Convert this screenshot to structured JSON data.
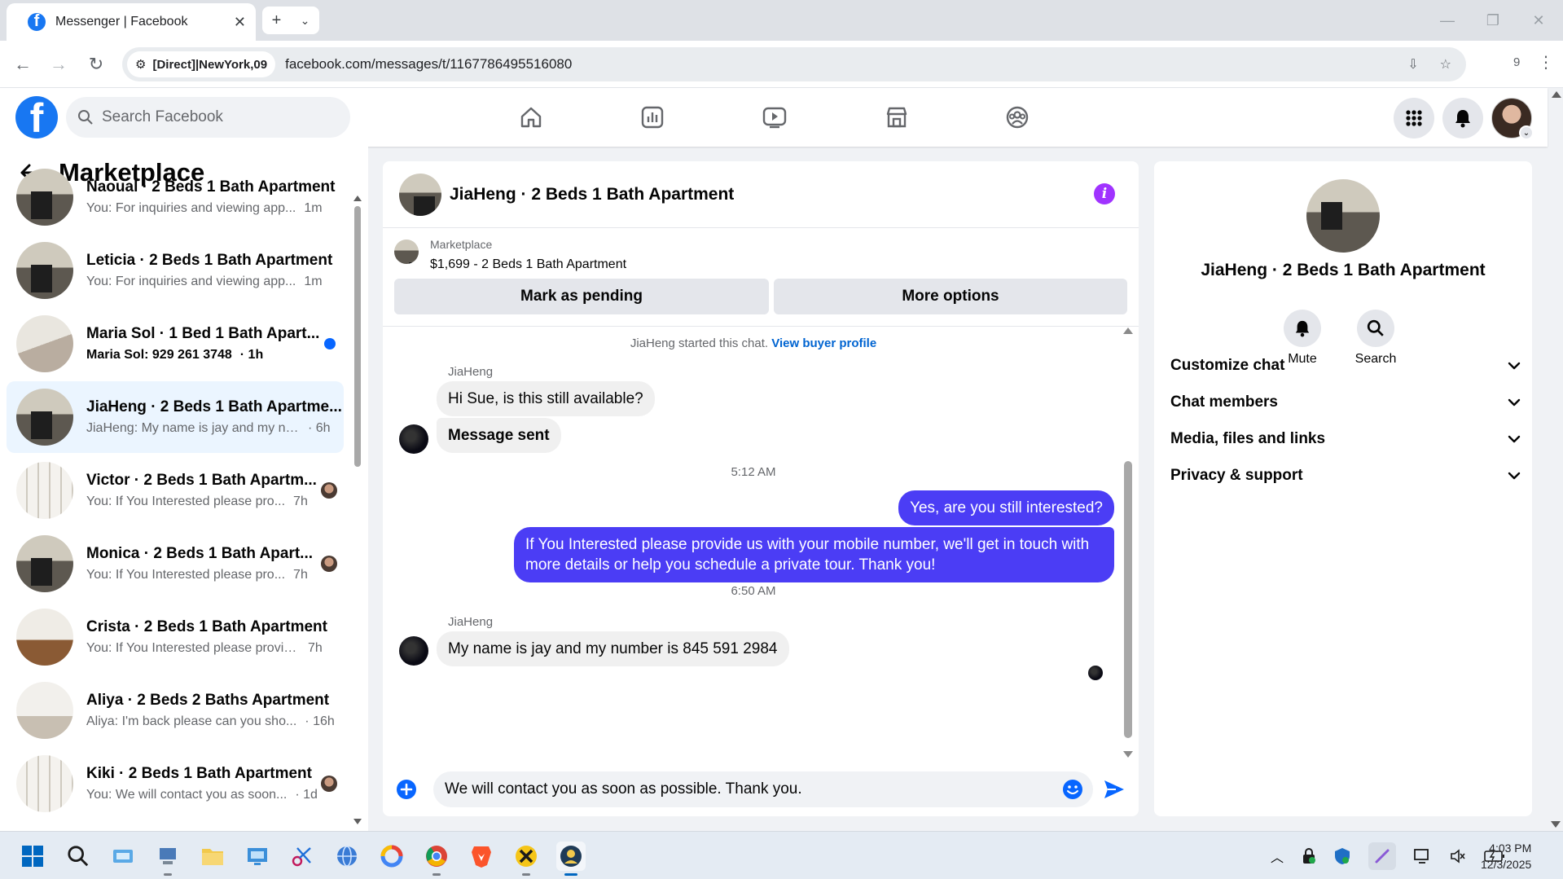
{
  "browser": {
    "tab_title": "Messenger | Facebook",
    "site_chip": "[Direct]|NewYork,09",
    "url": "facebook.com/messages/t/1167786495516080",
    "extensions_count": "9"
  },
  "facebook": {
    "search_placeholder": "Search Facebook"
  },
  "sidebar": {
    "title": "Marketplace",
    "conversations": [
      {
        "title": "Naoual · 2 Beds 1 Bath Apartment",
        "preview": "You: For inquiries and viewing app...",
        "time": "1m",
        "thumb": "kitchen"
      },
      {
        "title": "Leticia · 2 Beds 1 Bath Apartment",
        "preview": "You: For inquiries and viewing app...",
        "time": "1m",
        "thumb": "kitchen"
      },
      {
        "title": "Maria Sol · 1 Bed 1 Bath Apart...",
        "preview": "Maria Sol: 929 261 3748",
        "time": "· 1h",
        "thumb": "room",
        "unread": true
      },
      {
        "title": "JiaHeng · 2 Beds 1 Bath Apartme...",
        "preview": "JiaHeng: My name is jay and my nu...",
        "time": "· 6h",
        "thumb": "kitchen",
        "selected": true
      },
      {
        "title": "Victor · 2 Beds 1 Bath Apartm...",
        "preview": "You: If You Interested please pro...",
        "time": "7h",
        "thumb": "window",
        "seen": true
      },
      {
        "title": "Monica · 2 Beds 1 Bath Apart...",
        "preview": "You: If You Interested please pro...",
        "time": "7h",
        "thumb": "kitchen",
        "seen": true
      },
      {
        "title": "Crista · 2 Beds 1 Bath Apartment",
        "preview": "You: If You Interested please provid...",
        "time": "7h",
        "thumb": "floor"
      },
      {
        "title": "Aliya · 2 Beds 2 Baths Apartment",
        "preview": "Aliya: I'm back please can you sho...",
        "time": "· 16h",
        "thumb": "white"
      },
      {
        "title": "Kiki · 2 Beds 1 Bath Apartment",
        "preview": "You: We will contact you as soon...",
        "time": "· 1d",
        "thumb": "window",
        "seen": true
      }
    ]
  },
  "chat": {
    "title": "JiaHeng · 2 Beds 1 Bath Apartment",
    "marketplace_label": "Marketplace",
    "listing": "$1,699 - 2 Beds 1 Bath Apartment",
    "mark_pending": "Mark as pending",
    "more_options": "More options",
    "started_text": "JiaHeng started this chat.",
    "view_buyer": "View buyer profile",
    "sender1": "JiaHeng",
    "msg1": "Hi Sue, is this still available?",
    "msg2": "Message sent",
    "time1": "5:12 AM",
    "out1": "Yes, are you still interested?",
    "out2": "If You Interested please provide us with your mobile number, we'll get in touch with more details or help you schedule a private tour. Thank you!",
    "time2": "6:50 AM",
    "sender2": "JiaHeng",
    "msg3": "My name is jay and my number is 845 591 2984",
    "composer_text": "We will contact you as soon as possible. Thank you."
  },
  "info": {
    "title": "JiaHeng · 2 Beds 1 Bath Apartment",
    "mute": "Mute",
    "search": "Search",
    "sections": [
      "Customize chat",
      "Chat members",
      "Media, files and links",
      "Privacy & support"
    ]
  },
  "taskbar": {
    "time": "4:03 PM",
    "date": "12/3/2025"
  },
  "colors": {
    "fb_blue": "#1877f2",
    "outgoing_bubble": "#4b3df5",
    "info_icon": "#a033ff",
    "link": "#0064d1"
  }
}
